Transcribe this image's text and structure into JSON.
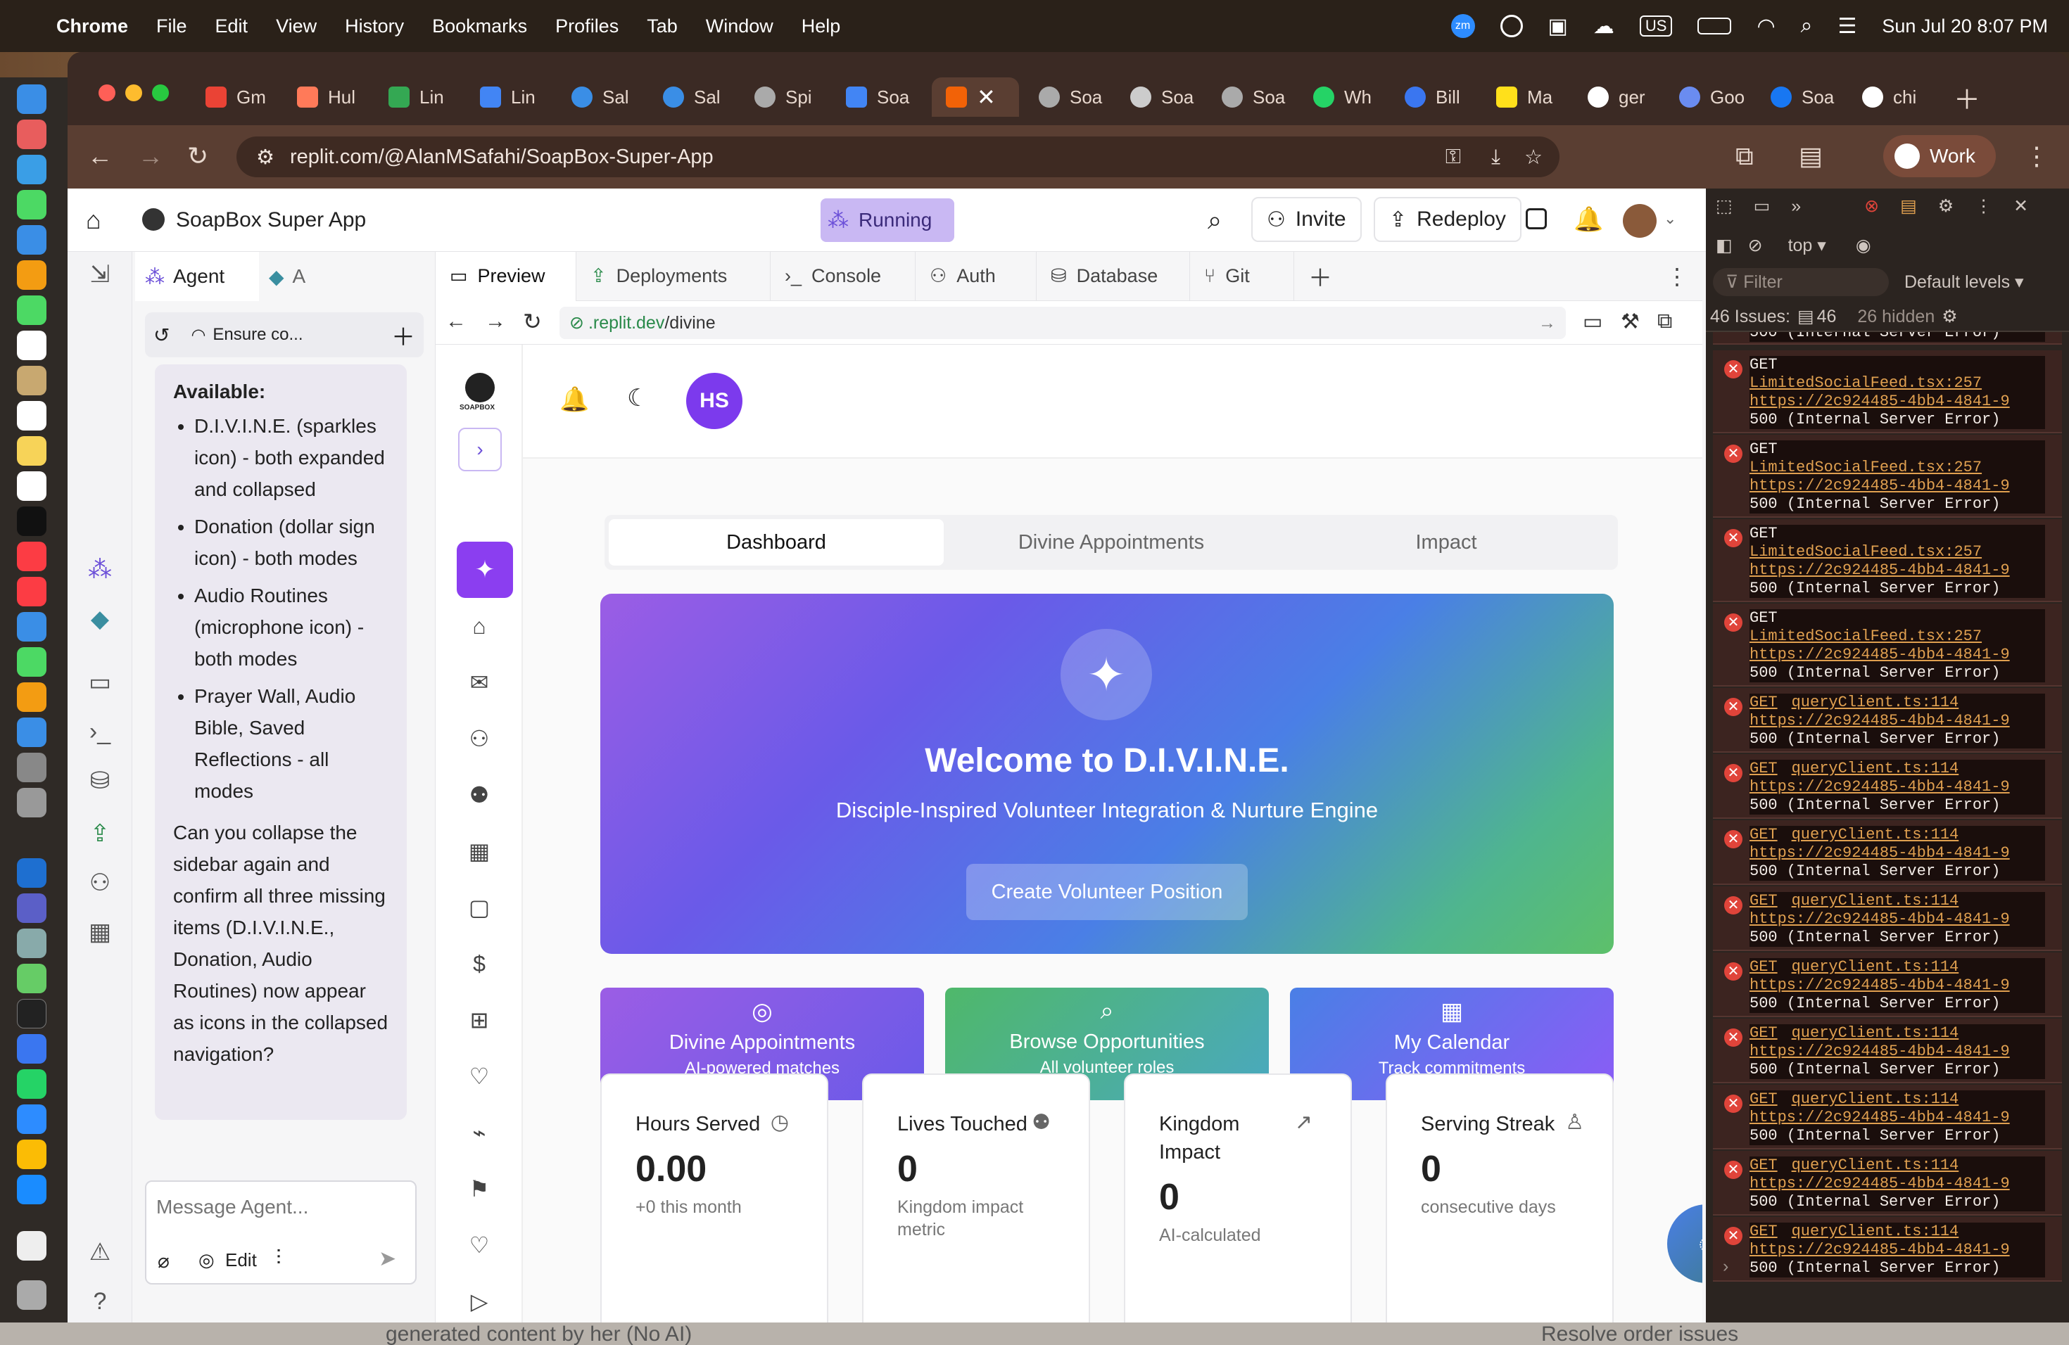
{
  "menubar": {
    "app": "Chrome",
    "items": [
      "File",
      "Edit",
      "View",
      "History",
      "Bookmarks",
      "Profiles",
      "Tab",
      "Window",
      "Help"
    ],
    "status_icons": [
      "zoom-icon",
      "onepassword-icon",
      "screen-icon",
      "weather-icon"
    ],
    "input_source": "US",
    "clock": "Sun Jul 20  8:07 PM"
  },
  "tabs": [
    "Gm",
    "Hul",
    "Lin",
    "Lin",
    "Sal",
    "Sal",
    "Spi",
    "Soa",
    "",
    "Soa",
    "Soa",
    "Soa",
    "Wh",
    "Bill",
    "Ma",
    "ger",
    "Goo",
    "Soa",
    "chi"
  ],
  "toolbar": {
    "url": "replit.com/@AlanMSafahi/SoapBox-Super-App",
    "profile": "Work"
  },
  "replit": {
    "project_name": "SoapBox Super App",
    "status": "Running",
    "invite": "Invite",
    "redeploy": "Redeploy"
  },
  "agent": {
    "tab_agent": "Agent",
    "tab_other": "A",
    "task": "Ensure co...",
    "message": {
      "heading": "Available:",
      "bullets": [
        "D.I.V.I.N.E. (sparkles icon) - both expanded and collapsed",
        "Donation (dollar sign icon) - both modes",
        "Audio Routines (microphone icon) - both modes",
        "Prayer Wall, Audio Bible, Saved Reflections - all modes"
      ],
      "question": "Can you collapse the sidebar again and confirm all three missing items (D.I.V.I.N.E., Donation, Audio Routines) now appear as icons in the collapsed navigation?"
    },
    "input_placeholder": "Message Agent...",
    "edit_label": "Edit"
  },
  "pane_tabs": [
    "Preview",
    "Deployments",
    "Console",
    "Auth",
    "Database",
    "Git"
  ],
  "preview_url": {
    "host": ".replit.dev",
    "path": "/divine"
  },
  "app": {
    "logo_text": "SOAPBOX",
    "avatar": "HS",
    "tabs": [
      "Dashboard",
      "Divine Appointments",
      "Impact"
    ],
    "hero": {
      "title": "Welcome to D.I.V.I.N.E.",
      "subtitle": "Disciple-Inspired Volunteer Integration & Nurture Engine",
      "button": "Create Volunteer Position"
    },
    "quick": [
      {
        "title": "Divine Appointments",
        "sub": "AI-powered matches",
        "color": "#8b5cf6"
      },
      {
        "title": "Browse Opportunities",
        "sub": "All volunteer roles",
        "color": "#4fb86a"
      },
      {
        "title": "My Calendar",
        "sub": "Track commitments",
        "color": "#5a6ee8"
      }
    ],
    "stats": [
      {
        "title": "Hours Served",
        "value": "0.00",
        "sub": "+0 this month"
      },
      {
        "title": "Lives Touched",
        "value": "0",
        "sub": "Kingdom impact metric"
      },
      {
        "title": "Kingdom Impact",
        "value": "0",
        "sub": "AI-calculated"
      },
      {
        "title": "Serving Streak",
        "value": "0",
        "sub": "consecutive days"
      }
    ]
  },
  "devtools": {
    "context": "top",
    "filter": "Filter",
    "levels": "Default levels",
    "issues_label": "46 Issues:",
    "issues_count": "46",
    "hidden": "26 hidden",
    "truncated_top": "500 (Internal Server Error)",
    "errors": [
      {
        "method": "GET",
        "source": "LimitedSocialFeed.tsx:257",
        "url": "https://2c924485-4bb4-4841-9",
        "status": "500 (Internal Server Error)"
      },
      {
        "method": "GET",
        "source": "LimitedSocialFeed.tsx:257",
        "url": "https://2c924485-4bb4-4841-9",
        "status": "500 (Internal Server Error)"
      },
      {
        "method": "GET",
        "source": "LimitedSocialFeed.tsx:257",
        "url": "https://2c924485-4bb4-4841-9",
        "status": "500 (Internal Server Error)"
      },
      {
        "method": "GET",
        "source": "LimitedSocialFeed.tsx:257",
        "url": "https://2c924485-4bb4-4841-9",
        "status": "500 (Internal Server Error)"
      },
      {
        "method": "GET",
        "source": "queryClient.ts:114",
        "url": "https://2c924485-4bb4-4841-9",
        "status": "500 (Internal Server Error)"
      },
      {
        "method": "GET",
        "source": "queryClient.ts:114",
        "url": "https://2c924485-4bb4-4841-9",
        "status": "500 (Internal Server Error)"
      },
      {
        "method": "GET",
        "source": "queryClient.ts:114",
        "url": "https://2c924485-4bb4-4841-9",
        "status": "500 (Internal Server Error)"
      },
      {
        "method": "GET",
        "source": "queryClient.ts:114",
        "url": "https://2c924485-4bb4-4841-9",
        "status": "500 (Internal Server Error)"
      },
      {
        "method": "GET",
        "source": "queryClient.ts:114",
        "url": "https://2c924485-4bb4-4841-9",
        "status": "500 (Internal Server Error)"
      },
      {
        "method": "GET",
        "source": "queryClient.ts:114",
        "url": "https://2c924485-4bb4-4841-9",
        "status": "500 (Internal Server Error)"
      },
      {
        "method": "GET",
        "source": "queryClient.ts:114",
        "url": "https://2c924485-4bb4-4841-9",
        "status": "500 (Internal Server Error)"
      },
      {
        "method": "GET",
        "source": "queryClient.ts:114",
        "url": "https://2c924485-4bb4-4841-9",
        "status": "500 (Internal Server Error)"
      },
      {
        "method": "GET",
        "source": "queryClient.ts:114",
        "url": "https://2c924485-4bb4-4841-9",
        "status": "500 (Internal Server Error)"
      }
    ]
  },
  "background": {
    "left_text": "generated content by her (No AI)",
    "right_text": "Resolve order issues"
  }
}
